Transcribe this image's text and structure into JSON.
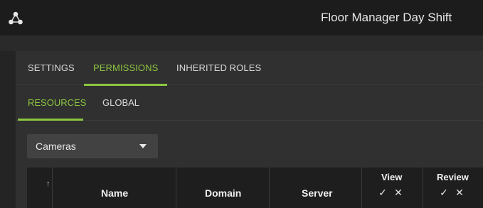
{
  "window": {
    "title": "Floor Manager Day Shift"
  },
  "tabs": [
    {
      "label": "SETTINGS",
      "active": false
    },
    {
      "label": "PERMISSIONS",
      "active": true
    },
    {
      "label": "INHERITED ROLES",
      "active": false
    }
  ],
  "subtabs": [
    {
      "label": "RESOURCES",
      "active": true
    },
    {
      "label": "GLOBAL",
      "active": false
    }
  ],
  "resource_type": {
    "selected": "Cameras"
  },
  "table": {
    "sort_glyph": "↑",
    "columns": [
      "Name",
      "Domain",
      "Server"
    ],
    "permissions": [
      {
        "title": "View",
        "allow": "✓",
        "deny": "✕"
      },
      {
        "title": "Review",
        "allow": "✓",
        "deny": "✕"
      }
    ]
  },
  "colors": {
    "accent": "#8cc63f",
    "topbar": "#1c1c1c",
    "panel": "#303030",
    "header": "#1e1e1e"
  }
}
